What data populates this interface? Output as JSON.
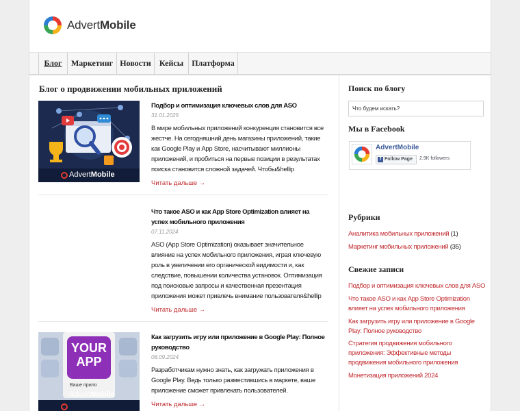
{
  "brand": {
    "name_light": "Advert",
    "name_bold": "Mobile"
  },
  "nav": {
    "items": [
      {
        "label": "Блог"
      },
      {
        "label": "Маркетинг"
      },
      {
        "label": "Новости"
      },
      {
        "label": "Кейсы"
      },
      {
        "label": "Платформа"
      }
    ]
  },
  "main": {
    "title": "Блог о продвижении мобильных приложений",
    "read_more": "Читать дальше →",
    "posts": [
      {
        "title": "Подбор и оптимизация ключевых слов для ASO",
        "date": "31.01.2025",
        "excerpt": "В мире мобильных приложений конкуренция становится все жестче. На сегодняшний день магазины приложений, такие как Google Play и App Store, насчитывают миллионы приложений, и пробиться на первые позиции в результатах поиска становится сложной задачей. Чтобы&hellip",
        "thumb_caption_light": "Advert",
        "thumb_caption_bold": "Mobile"
      },
      {
        "title": "Что такое ASO и как App Store Optimization влияет на успех мобильного приложения",
        "date": "07.11.2024",
        "excerpt": "ASO (App Store Optimization) оказывает значительное влияние на успех мобильного приложения, играя ключевую роль в увеличении его органической видимости и, как следствие, повышении количества установок. Оптимизация под поисковые запросы и качественная презентация приложения может привлечь внимание пользователя&hellip"
      },
      {
        "title": "Как загрузить игру или приложение в Google Play: Полное руководство",
        "date": "08.09.2024",
        "excerpt": "Разработчикам нужно знать, как загружать приложения в Google Play. Ведь только разместившись в маркете, ваше приложение сможет привлекать пользователей.",
        "thumb_app_line1": "YOUR",
        "thumb_app_line2": "APP",
        "thumb_app_sub": "Ваше прило",
        "thumb_caption_light": "Advert",
        "thumb_caption_bold": "Mobile"
      }
    ]
  },
  "sidebar": {
    "search_title": "Поиск по блогу",
    "search_placeholder": "Что будем искать?",
    "facebook_title": "Мы в Facebook",
    "facebook": {
      "page_name": "AdvertMobile",
      "follow_label": "Follow Page",
      "followers": "2.9K followers",
      "f_glyph": "f"
    },
    "categories_title": "Рубрики",
    "categories": [
      {
        "label": "Аналитика мобильных приложений",
        "count": "(1)"
      },
      {
        "label": "Маркетинг мобильных приложений",
        "count": "(35)"
      }
    ],
    "recent_title": "Свежие записи",
    "recent": [
      "Подбор и оптимизация ключевых слов для ASO",
      "Что такое ASO и как App Store Optimization влияет на успех мобильного приложения",
      "Как загрузить игру или приложение в Google Play: Полное руководство",
      "Стратегия продвижения мобильного приложения: Эффективные методы продвижения мобильного приложения",
      "Монетизация приложений 2024"
    ]
  },
  "colors": {
    "link": "#c0282d",
    "thumb_navy": "#1b2a4e",
    "facebook": "#3b5998"
  }
}
